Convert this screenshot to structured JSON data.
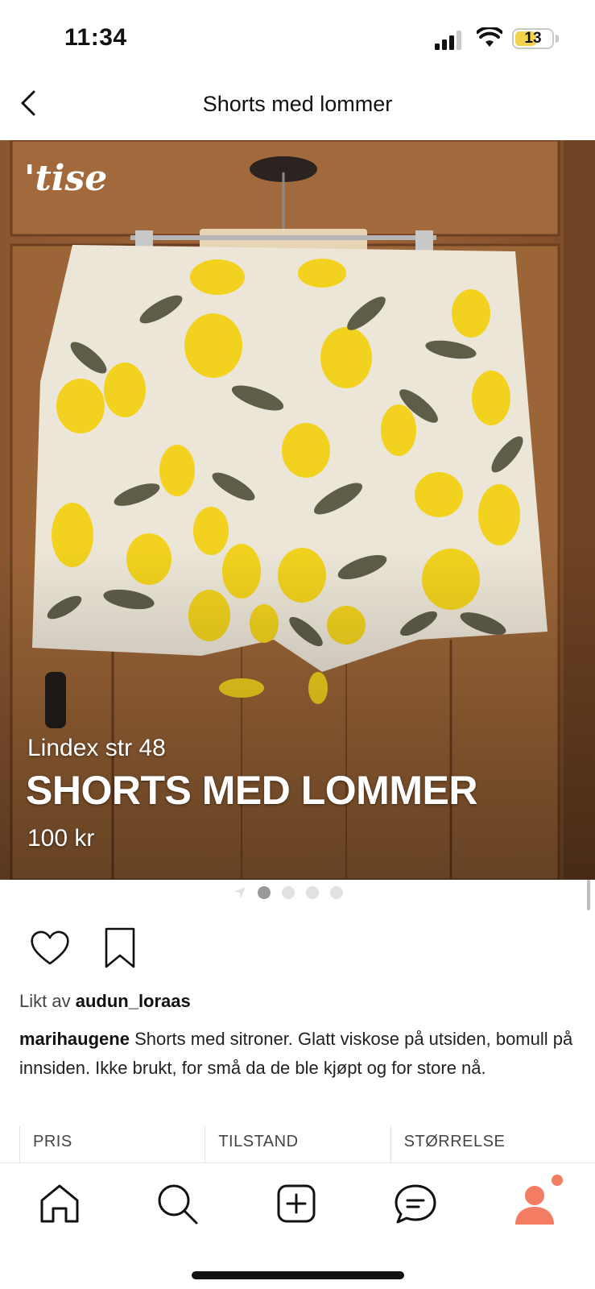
{
  "status": {
    "time": "11:34",
    "battery": "13",
    "battery_level": 0.13,
    "signal_icon": "cellular-signal-icon",
    "wifi_icon": "wifi-icon",
    "battery_color": "#f4d34a"
  },
  "nav": {
    "back_icon": "chevron-left-icon",
    "title": "Shorts med lommer"
  },
  "hero": {
    "brand": "'tise",
    "subtitle": "Lindex str 48",
    "title": "SHORTS MED LOMMER",
    "price": "100 kr"
  },
  "pager": {
    "dots": 4,
    "active_index": 0
  },
  "actions": {
    "like_icon": "heart-icon",
    "save_icon": "bookmark-icon"
  },
  "liked": {
    "prefix": "Likt av",
    "user": "audun_loraas"
  },
  "description": {
    "user": "marihaugene",
    "text": "Shorts med sitroner. Glatt viskose på utsiden, bomull på innsiden. Ikke brukt, for små da de ble kjøpt og for store nå."
  },
  "info_table": {
    "headers": [
      "PRIS",
      "TILSTAND",
      "STØRRELSE"
    ]
  },
  "tabbar": {
    "items": [
      "home-icon",
      "search-icon",
      "add-icon",
      "chat-icon",
      "profile-icon"
    ],
    "accent": "#f47c63"
  }
}
